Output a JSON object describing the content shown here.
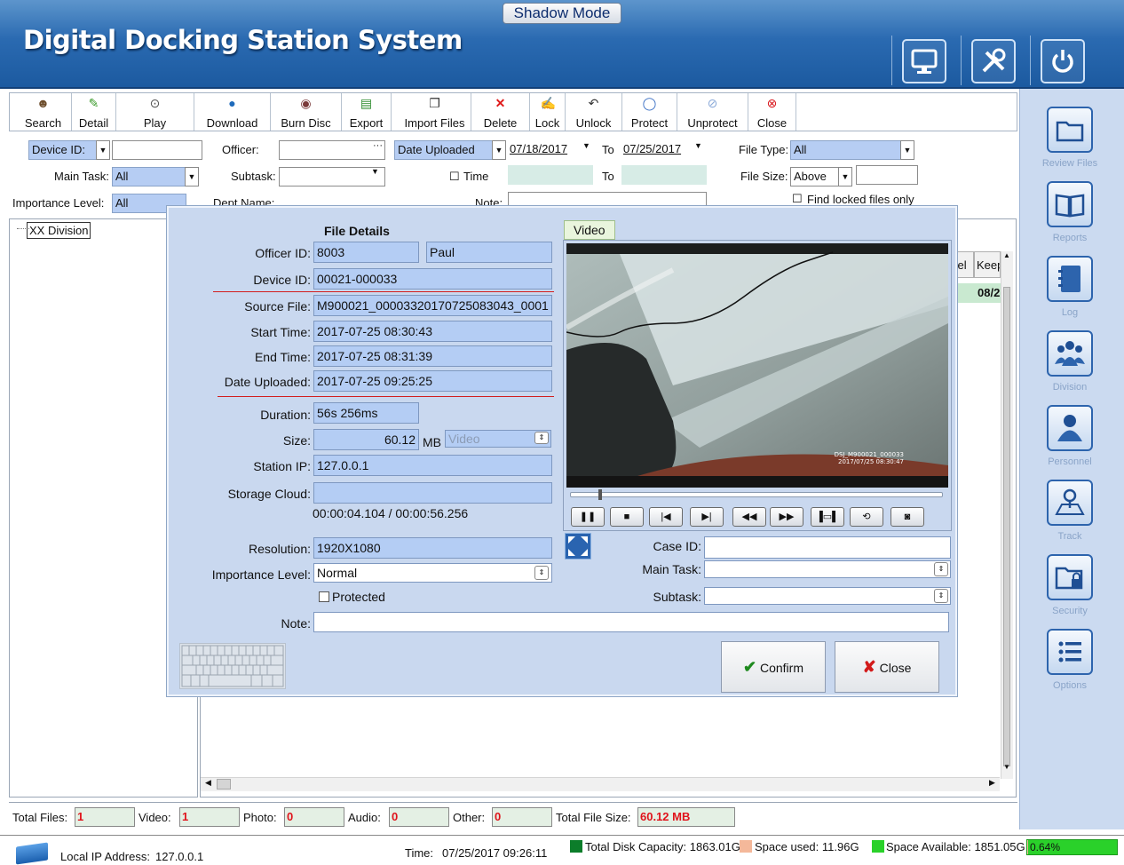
{
  "header": {
    "title": "Digital Docking Station System",
    "mode_label": "Shadow Mode"
  },
  "toolbar": [
    {
      "label": "Search",
      "icon": "search-icon"
    },
    {
      "label": "Detail",
      "icon": "detail-icon"
    },
    {
      "label": "Play",
      "icon": "play-icon"
    },
    {
      "label": "Download",
      "icon": "download-icon"
    },
    {
      "label": "Burn Disc",
      "icon": "burn-disc-icon"
    },
    {
      "label": "Export",
      "icon": "export-icon"
    },
    {
      "label": "Import Files",
      "icon": "import-icon"
    },
    {
      "label": "Delete",
      "icon": "delete-icon"
    },
    {
      "label": "Lock",
      "icon": "lock-icon"
    },
    {
      "label": "Unlock",
      "icon": "unlock-icon"
    },
    {
      "label": "Protect",
      "icon": "shield-icon"
    },
    {
      "label": "Unprotect",
      "icon": "unshield-icon"
    },
    {
      "label": "Close",
      "icon": "close-icon"
    }
  ],
  "filters": {
    "device_id_label": "Device ID:",
    "officer_label": "Officer:",
    "main_task_label": "Main Task:",
    "main_task_value": "All",
    "subtask_label": "Subtask:",
    "importance_label": "Importance Level:",
    "importance_value": "All",
    "dept_label": "Dept Name:",
    "date_mode": "Date Uploaded",
    "date_from": "07/18/2017",
    "to_label": "To",
    "date_to": "07/25/2017",
    "time_label": "Time",
    "note_label": "Note:",
    "file_type_label": "File Type:",
    "file_type_value": "All",
    "file_size_label": "File Size:",
    "file_size_mode": "Above",
    "locked_only_label": "Find locked files only"
  },
  "tree": {
    "root": "XX Division"
  },
  "grid": {
    "col_level": "vel",
    "col_keep": "Keep",
    "cell_keep": "08/2"
  },
  "status": {
    "total_files_label": "Total Files:",
    "total_files": "1",
    "video_label": "Video:",
    "video": "1",
    "photo_label": "Photo:",
    "photo": "0",
    "audio_label": "Audio:",
    "audio": "0",
    "other_label": "Other:",
    "other": "0",
    "total_size_label": "Total File Size:",
    "total_size": "60.12 MB"
  },
  "bottom": {
    "ip_label": "Local IP Address:",
    "ip": "127.0.0.1",
    "time_label": "Time:",
    "time": "07/25/2017 09:26:11",
    "disk_capacity": "Total Disk Capacity: 1863.01G",
    "space_used": "Space used: 11.96G",
    "space_available": "Space Available: 1851.05G",
    "usage_percent": "0.64%",
    "usage_fraction": 0.0064,
    "colors": {
      "capacity": "#0c7d2a",
      "used": "#f4b89a",
      "available": "#2ad12a"
    }
  },
  "dialog": {
    "title": "File Details",
    "officer_id_label": "Officer ID:",
    "officer_id": "8003",
    "officer_name": "Paul",
    "device_id_label": "Device ID:",
    "device_id": "00021-000033",
    "source_file_label": "Source File:",
    "source_file": "M900021_00003320170725083043_0001",
    "start_time_label": "Start Time:",
    "start_time": "2017-07-25 08:30:43",
    "end_time_label": "End Time:",
    "end_time": "2017-07-25 08:31:39",
    "date_uploaded_label": "Date Uploaded:",
    "date_uploaded": "2017-07-25 09:25:25",
    "duration_label": "Duration:",
    "duration": "56s 256ms",
    "size_label": "Size:",
    "size": "60.12",
    "size_unit": "MB",
    "media_type": "Video",
    "station_ip_label": "Station IP:",
    "station_ip": "127.0.0.1",
    "storage_cloud_label": "Storage Cloud:",
    "storage_cloud": "",
    "playback_position": "00:00:04.104 / 00:00:56.256",
    "playback_fraction": 0.073,
    "resolution_label": "Resolution:",
    "resolution": "1920X1080",
    "importance_label": "Importance Level:",
    "importance": "Normal",
    "protected_label": "Protected",
    "note_label": "Note:",
    "case_id_label": "Case ID:",
    "main_task_label": "Main Task:",
    "subtask_label": "Subtask:",
    "video_tab": "Video",
    "overlay_line1": "DSJ_M900021_000033",
    "overlay_line2": "2017/07/25 08:30:47",
    "confirm_label": "Confirm",
    "close_label": "Close"
  },
  "sidebar": [
    {
      "label": "Review Files",
      "icon": "folder-icon"
    },
    {
      "label": "Reports",
      "icon": "book-icon"
    },
    {
      "label": "Log",
      "icon": "notebook-icon"
    },
    {
      "label": "Division",
      "icon": "group-icon"
    },
    {
      "label": "Personnel",
      "icon": "person-icon"
    },
    {
      "label": "Track",
      "icon": "map-pin-icon"
    },
    {
      "label": "Security",
      "icon": "locked-folder-icon"
    },
    {
      "label": "Options",
      "icon": "list-icon"
    }
  ]
}
